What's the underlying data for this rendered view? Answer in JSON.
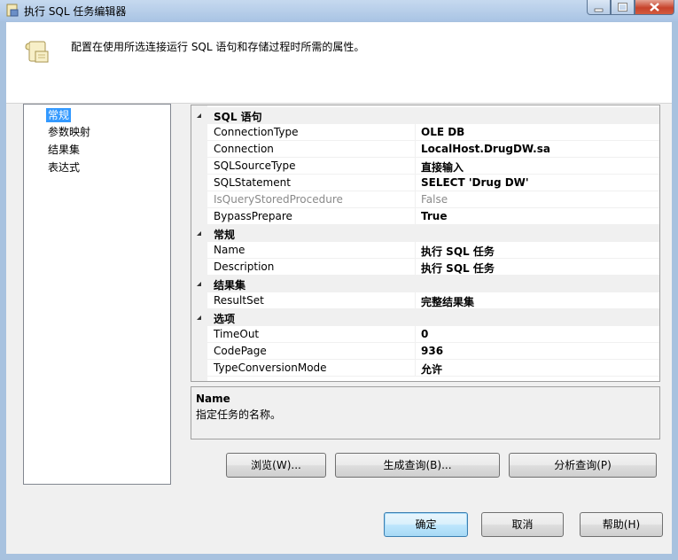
{
  "window": {
    "title": "执行 SQL 任务编辑器"
  },
  "header": {
    "description": "配置在使用所选连接运行 SQL 语句和存储过程时所需的属性。",
    "icon": "scroll-icon"
  },
  "nav": {
    "items": [
      {
        "label": "常规",
        "selected": true
      },
      {
        "label": "参数映射",
        "selected": false
      },
      {
        "label": "结果集",
        "selected": false
      },
      {
        "label": "表达式",
        "selected": false
      }
    ]
  },
  "properties": {
    "categories": [
      {
        "label": "SQL 语句",
        "rows": [
          {
            "name": "ConnectionType",
            "value": "OLE DB",
            "disabled": false
          },
          {
            "name": "Connection",
            "value": "LocalHost.DrugDW.sa",
            "disabled": false
          },
          {
            "name": "SQLSourceType",
            "value": "直接输入",
            "disabled": false
          },
          {
            "name": "SQLStatement",
            "value": "SELECT 'Drug DW'",
            "disabled": false
          },
          {
            "name": "IsQueryStoredProcedure",
            "value": "False",
            "disabled": true
          },
          {
            "name": "BypassPrepare",
            "value": "True",
            "disabled": false
          }
        ]
      },
      {
        "label": "常规",
        "rows": [
          {
            "name": "Name",
            "value": "执行 SQL 任务",
            "disabled": false
          },
          {
            "name": "Description",
            "value": "执行 SQL 任务",
            "disabled": false
          }
        ]
      },
      {
        "label": "结果集",
        "rows": [
          {
            "name": "ResultSet",
            "value": "完整结果集",
            "disabled": false
          }
        ]
      },
      {
        "label": "选项",
        "rows": [
          {
            "name": "TimeOut",
            "value": "0",
            "disabled": false
          },
          {
            "name": "CodePage",
            "value": "936",
            "disabled": false
          },
          {
            "name": "TypeConversionMode",
            "value": "允许",
            "disabled": false
          }
        ]
      }
    ]
  },
  "description_panel": {
    "title": "Name",
    "text": "指定任务的名称。"
  },
  "buttons": {
    "browse": "浏览(W)...",
    "build_query": "生成查询(B)...",
    "parse_query": "分析查询(P)",
    "ok": "确定",
    "cancel": "取消",
    "help": "帮助(H)"
  },
  "colors": {
    "selection": "#3399ff",
    "frame": "#a8c2df",
    "close_button": "#c7432c"
  }
}
